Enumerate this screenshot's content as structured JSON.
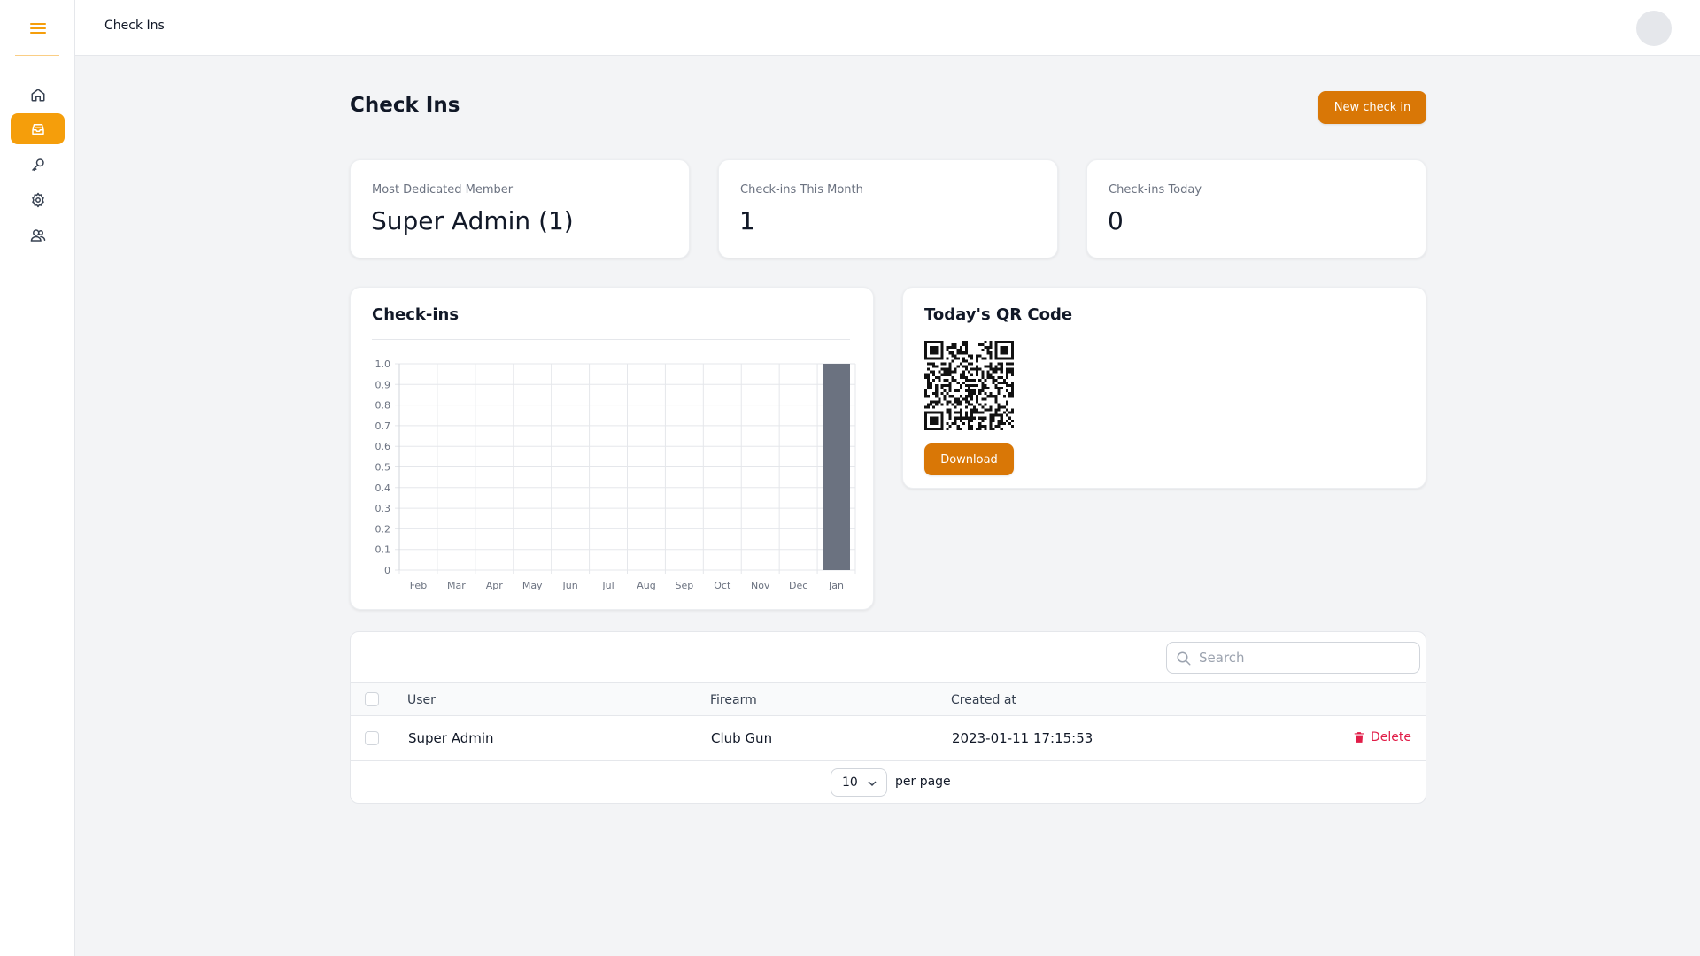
{
  "topbar": {
    "title": "Check Ins"
  },
  "sidebar": {
    "items": [
      {
        "name": "home-icon",
        "active": false
      },
      {
        "name": "inbox-icon",
        "active": true
      },
      {
        "name": "key-icon",
        "active": false
      },
      {
        "name": "gear-icon",
        "active": false
      },
      {
        "name": "users-icon",
        "active": false
      }
    ]
  },
  "header": {
    "title": "Check Ins",
    "new_button": "New check in"
  },
  "stats": [
    {
      "label": "Most Dedicated Member",
      "value": "Super Admin (1)"
    },
    {
      "label": "Check-ins This Month",
      "value": "1"
    },
    {
      "label": "Check-ins Today",
      "value": "0"
    }
  ],
  "chart_card": {
    "title": "Check-ins"
  },
  "chart_data": {
    "type": "bar",
    "categories": [
      "Feb",
      "Mar",
      "Apr",
      "May",
      "Jun",
      "Jul",
      "Aug",
      "Sep",
      "Oct",
      "Nov",
      "Dec",
      "Jan"
    ],
    "values": [
      0,
      0,
      0,
      0,
      0,
      0,
      0,
      0,
      0,
      0,
      0,
      1
    ],
    "ylim": [
      0,
      1.0
    ],
    "yticks": [
      "0",
      "0.1",
      "0.2",
      "0.3",
      "0.4",
      "0.5",
      "0.6",
      "0.7",
      "0.8",
      "0.9",
      "1.0"
    ],
    "grid": true,
    "bar_color": "#6b7280"
  },
  "qr_card": {
    "title": "Today's QR Code",
    "download": "Download"
  },
  "table": {
    "search_placeholder": "Search",
    "columns": {
      "user": "User",
      "firearm": "Firearm",
      "created_at": "Created at"
    },
    "rows": [
      {
        "user": "Super Admin",
        "firearm": "Club Gun",
        "created_at": "2023-01-11 17:15:53",
        "action": "Delete"
      }
    ],
    "per_page_value": "10",
    "per_page_label": "per page"
  },
  "colors": {
    "accent": "#f59e0b",
    "button": "#d97706",
    "danger": "#e11d48"
  }
}
